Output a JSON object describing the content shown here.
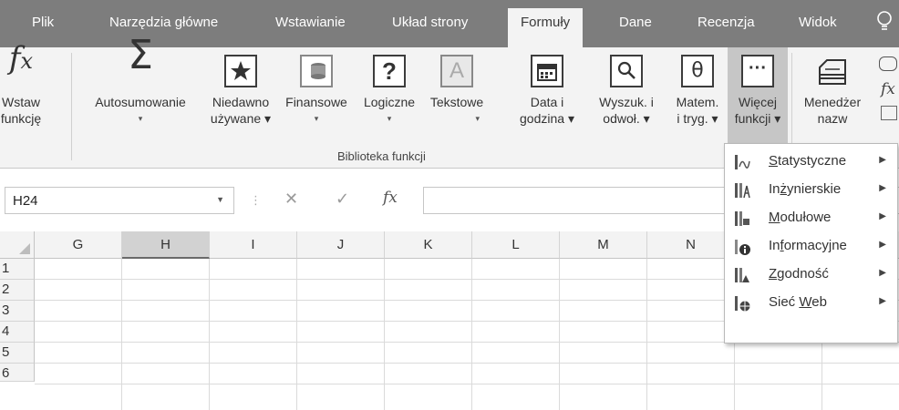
{
  "tabs": [
    {
      "label": "Plik"
    },
    {
      "label": "Narzędzia główne"
    },
    {
      "label": "Wstawianie"
    },
    {
      "label": "Układ strony"
    },
    {
      "label": "Formuły"
    },
    {
      "label": "Dane"
    },
    {
      "label": "Recenzja"
    },
    {
      "label": "Widok"
    }
  ],
  "active_tab": "Formuły",
  "ribbon": {
    "insert_function": {
      "line1": "Wstaw",
      "line2": "funkcję"
    },
    "autosum": {
      "line1": "Autosumowanie",
      "arrow": "▾"
    },
    "recent": {
      "line1": "Niedawno",
      "line2": "używane ▾"
    },
    "financial": {
      "line1": "Finansowe",
      "arrow": "▾"
    },
    "logical": {
      "line1": "Logiczne",
      "arrow": "▾"
    },
    "text": {
      "line1": "Tekstowe",
      "arrow": "▾"
    },
    "datetime": {
      "line1": "Data i",
      "line2": "godzina ▾"
    },
    "lookup": {
      "line1": "Wyszuk. i",
      "line2": "odwoł. ▾"
    },
    "math": {
      "line1": "Matem.",
      "line2": "i tryg. ▾"
    },
    "more": {
      "line1": "Więcej",
      "line2": "funkcji ▾"
    },
    "name_manager": {
      "line1": "Menedżer",
      "line2": "nazw"
    },
    "group_label": "Biblioteka funkcji"
  },
  "formula_bar": {
    "name_box": "H24",
    "fx": "fx",
    "cancel": "✕",
    "enter": "✓",
    "sep": "⋮",
    "dropdown": "▼"
  },
  "grid": {
    "columns": [
      "G",
      "H",
      "I",
      "J",
      "K",
      "L",
      "M",
      "N"
    ],
    "selected_column": "H",
    "rows": [
      "1",
      "2",
      "3",
      "4",
      "5",
      "6"
    ]
  },
  "more_functions_menu": [
    {
      "pre": "",
      "u": "S",
      "post": "tatystyczne",
      "icon": "statistical-icon"
    },
    {
      "pre": "In",
      "u": "ż",
      "post": "ynierskie",
      "icon": "engineering-icon"
    },
    {
      "pre": "",
      "u": "M",
      "post": "odułowe",
      "icon": "cube-icon"
    },
    {
      "pre": "In",
      "u": "f",
      "post": "ormacyjne",
      "icon": "information-icon"
    },
    {
      "pre": "",
      "u": "Z",
      "post": "godność",
      "icon": "compatibility-icon"
    },
    {
      "pre": "Sieć ",
      "u": "W",
      "post": "eb",
      "icon": "web-icon"
    }
  ],
  "colors": {
    "tab_bar": "#7d7d7d",
    "ribbon": "#f3f3f3",
    "selected_button": "#c6c6c6",
    "selected_column": "#d2d2d2"
  }
}
